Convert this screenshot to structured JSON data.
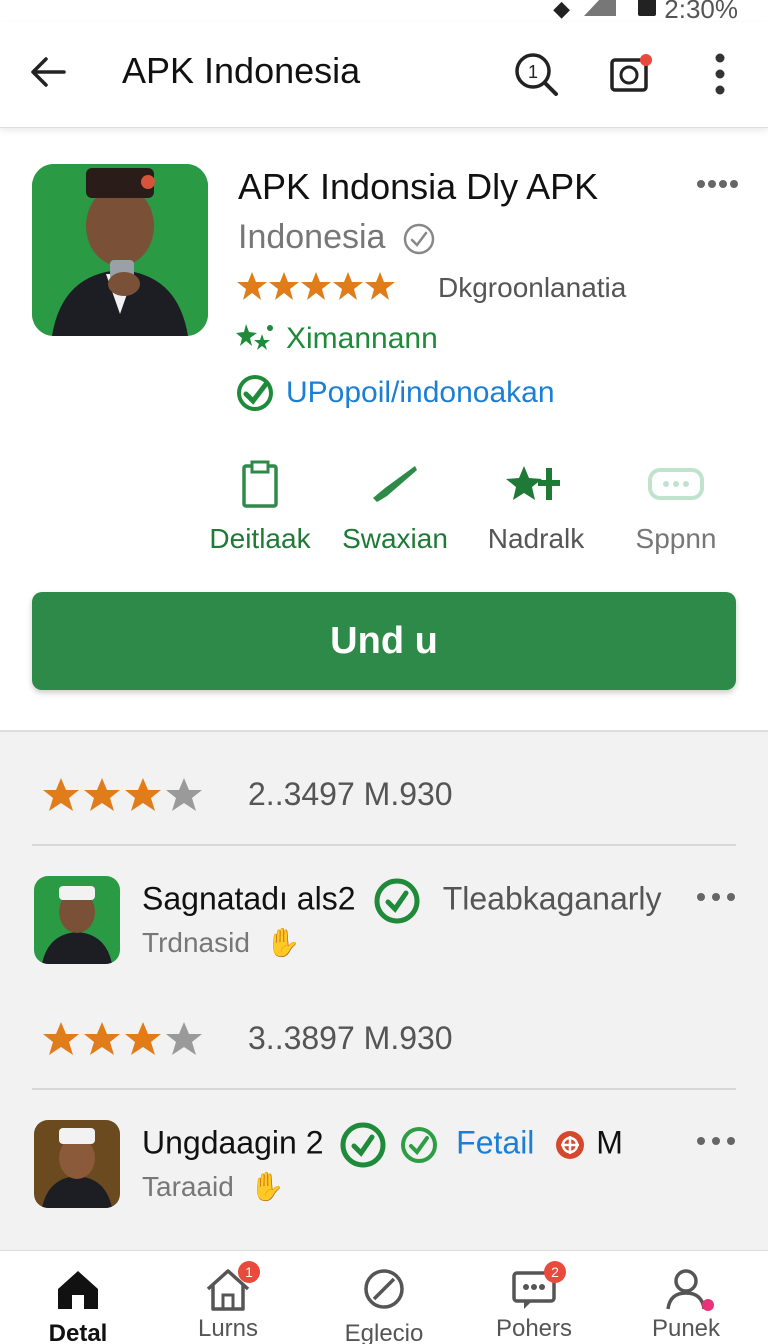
{
  "status_bar": {
    "time": "2:30%"
  },
  "appbar": {
    "title": "APK Indonesia"
  },
  "app": {
    "name": "APK Indonsia Dly APK",
    "developer": "Indonesia",
    "rating_stars": 5,
    "developer_sub": "Dkgroonlanatia",
    "badge_primary": "Ximannann",
    "badge_link": "UPopoil/indonoakan"
  },
  "actions": [
    {
      "label": "Deitlaak",
      "icon": "clipboard-icon"
    },
    {
      "label": "Swaxian",
      "icon": "check-icon"
    },
    {
      "label": "Nadralk",
      "icon": "sparkle-icon"
    },
    {
      "label": "Sppnn",
      "icon": "chat-icon"
    }
  ],
  "install_button": {
    "label": "Und u"
  },
  "reviews": [
    {
      "rating_stars": 3.5,
      "rating_text": "2..3497  M.930",
      "name": "Sagnatadı als2",
      "extra": "Tleabkaganarly",
      "sub": "Trdnasid"
    },
    {
      "rating_stars": 3.5,
      "rating_text": "3..3897  M.930",
      "name": "Ungdaagin 2",
      "extra_link": "Fetail",
      "extra_tail": "M",
      "sub": "Taraaid"
    }
  ],
  "bottom_nav": [
    {
      "label": "Detal",
      "icon": "home-icon",
      "active": true
    },
    {
      "label": "Lurns",
      "icon": "house-icon",
      "badge": "1"
    },
    {
      "label": "Eglecio",
      "icon": "circle-slash-icon"
    },
    {
      "label": "Pohers",
      "icon": "message-icon",
      "badge": "2"
    },
    {
      "label": "Punek",
      "icon": "profile-icon"
    }
  ],
  "colors": {
    "accent_green": "#2e8a48",
    "star_orange": "#e07d1a",
    "link_blue": "#1c7fd6"
  }
}
